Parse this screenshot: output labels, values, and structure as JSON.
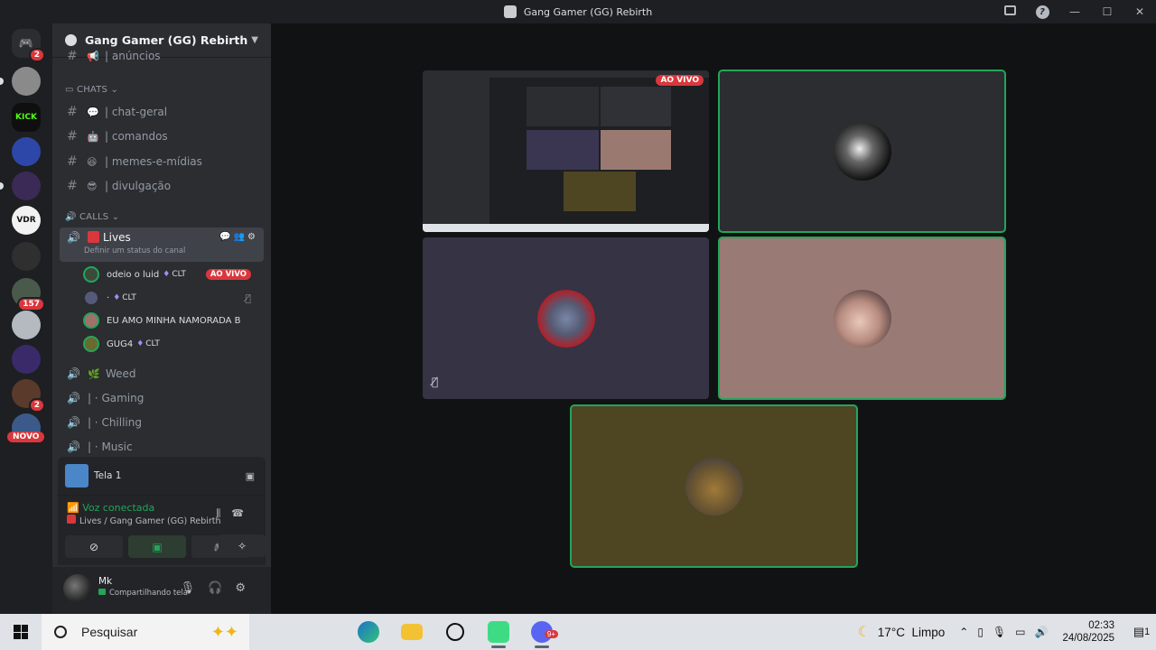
{
  "window": {
    "title": "Gang Gamer (GG) Rebirth"
  },
  "guilds": {
    "home_badge": "2",
    "kick_label": "KICK",
    "vdr_label": "VDR",
    "badge_157": "157",
    "badge_2": "2",
    "novo_label": "NOVO"
  },
  "server": {
    "name": "Gang Gamer (GG) Rebirth"
  },
  "channels": {
    "top_partial": "| anúncios",
    "cat_chats": "CHATS",
    "chat_geral": "| chat-geral",
    "comandos": "| comandos",
    "memes": "| memes-e-mídias",
    "divulgacao": "| divulgação",
    "cat_calls": "CALLS",
    "lives": "Lives",
    "lives_status": "Definir um status do canal",
    "weed": "Weed",
    "gaming": "|  · Gaming",
    "chilling": "|  · Chilling",
    "music": "|  · Music"
  },
  "voice_users": [
    {
      "name": "odeio o luid",
      "tag": "CLT",
      "live": "AO VIVO"
    },
    {
      "name": "·",
      "tag": "CLT"
    },
    {
      "name": "EU AMO MINHA NAMORADA B"
    },
    {
      "name": "GUG4",
      "tag": "CLT"
    }
  ],
  "stream_panel": {
    "label": "Tela 1"
  },
  "voice_panel": {
    "status": "Voz conectada",
    "location": "Lives / Gang Gamer (GG) Rebirth"
  },
  "user": {
    "name": "Mk",
    "status": "Compartilhando tela"
  },
  "stage": {
    "live_badge": "AO VIVO"
  },
  "colors": {
    "green": "#23a55a",
    "red": "#da373c",
    "bg": "#111214"
  },
  "taskbar": {
    "search_placeholder": "Pesquisar",
    "temperature": "17°C",
    "weather": "Limpo",
    "time": "02:33",
    "date": "24/08/2025",
    "notif_count": "1",
    "discord_badge": "9+"
  }
}
